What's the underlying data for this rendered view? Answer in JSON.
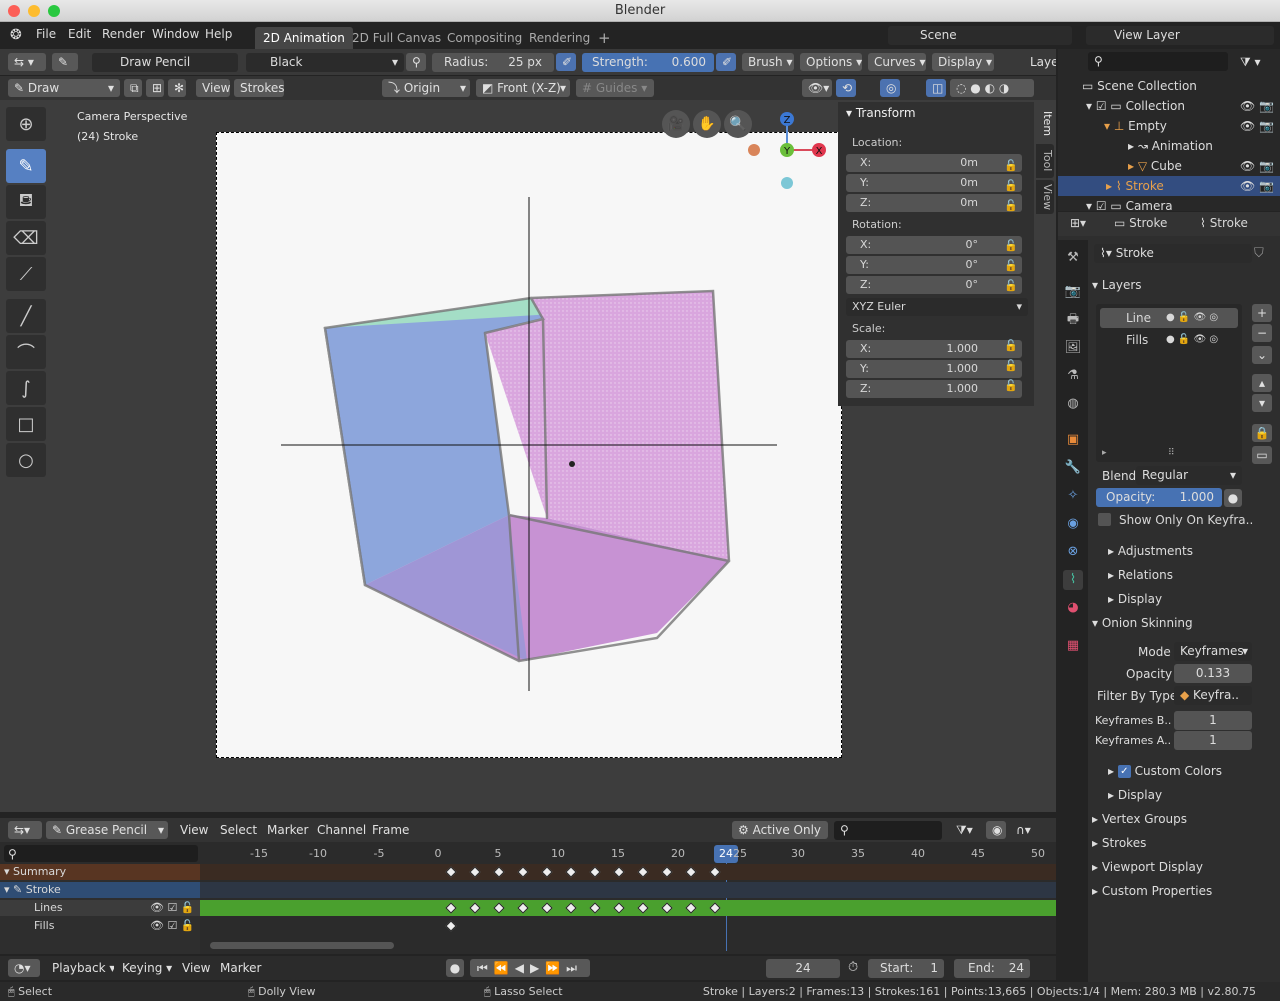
{
  "window": {
    "title": "Blender"
  },
  "menu": [
    "File",
    "Edit",
    "Render",
    "Window",
    "Help"
  ],
  "workspaces": [
    "2D Animation",
    "2D Full Canvas",
    "Compositing",
    "Rendering"
  ],
  "scene": {
    "label": "Scene",
    "view_layer": "View Layer"
  },
  "tool_header": {
    "brush": "Draw Pencil",
    "material": "Black",
    "radius_label": "Radius:",
    "radius_value": "25 px",
    "strength_label": "Strength:",
    "strength_value": "0.600",
    "brush_menu": "Brush",
    "options_menu": "Options",
    "curves_menu": "Curves",
    "display_menu": "Display",
    "layer_menu": "Layer"
  },
  "view_header": {
    "mode": "Draw",
    "view": "View",
    "strokes": "Strokes",
    "origin": "Origin",
    "plane": "Front (X-Z)",
    "guides": "Guides"
  },
  "viewport": {
    "camera": "Camera Perspective",
    "object": "(24) Stroke"
  },
  "gizmo": {
    "z": "Z",
    "y": "Y",
    "x": "X"
  },
  "npanel": {
    "title": "Transform",
    "location": "Location:",
    "rotation": "Rotation:",
    "scale": "Scale:",
    "euler": "XYZ Euler",
    "loc": [
      {
        "axis": "X:",
        "value": "0m"
      },
      {
        "axis": "Y:",
        "value": "0m"
      },
      {
        "axis": "Z:",
        "value": "0m"
      }
    ],
    "rot": [
      {
        "axis": "X:",
        "value": "0°"
      },
      {
        "axis": "Y:",
        "value": "0°"
      },
      {
        "axis": "Z:",
        "value": "0°"
      }
    ],
    "scl": [
      {
        "axis": "X:",
        "value": "1.000"
      },
      {
        "axis": "Y:",
        "value": "1.000"
      },
      {
        "axis": "Z:",
        "value": "1.000"
      }
    ],
    "tabs": [
      "Item",
      "Tool",
      "View"
    ]
  },
  "outliner": {
    "rows": [
      "Scene Collection",
      "Collection",
      "Empty",
      "Animation",
      "Cube",
      "Stroke",
      "Camera"
    ]
  },
  "properties": {
    "header_obj": "Stroke",
    "header_data": "Stroke",
    "datablock": "Stroke",
    "layers_title": "Layers",
    "layers": [
      "Line",
      "Fills"
    ],
    "blend_label": "Blend:",
    "blend_value": "Regular",
    "opacity_label": "Opacity:",
    "opacity_value": "1.000",
    "show_only": "Show Only On Keyfra..",
    "subs": [
      "Adjustments",
      "Relations",
      "Display"
    ],
    "onion": "Onion Skinning",
    "mode_label": "Mode",
    "mode_value": "Keyframes",
    "os_opacity_label": "Opacity",
    "os_opacity_value": "0.133",
    "filter_label": "Filter By Type",
    "filter_value": "Keyfra..",
    "kb_label": "Keyframes B..",
    "kb_value": "1",
    "ka_label": "Keyframes A..",
    "ka_value": "1",
    "custom_colors": "Custom Colors",
    "display2": "Display",
    "bottom": [
      "Vertex Groups",
      "Strokes",
      "Viewport Display",
      "Custom Properties"
    ]
  },
  "dopesheet": {
    "mode": "Grease Pencil",
    "menus": [
      "View",
      "Select",
      "Marker",
      "Channel",
      "Frame"
    ],
    "active_only": "Active Only",
    "ruler": [
      "-15",
      "-10",
      "-5",
      "0",
      "5",
      "10",
      "15",
      "20",
      "24",
      "25",
      "30",
      "35",
      "40",
      "45",
      "50"
    ],
    "channels": [
      "Summary",
      "Stroke",
      "Lines",
      "Fills"
    ]
  },
  "playback": {
    "menus": [
      "Playback",
      "Keying",
      "View",
      "Marker"
    ],
    "frame": "24",
    "start_label": "Start:",
    "start": "1",
    "end_label": "End:",
    "end": "24"
  },
  "status": {
    "select": "Select",
    "dolly": "Dolly View",
    "lasso": "Lasso Select",
    "info": "Stroke | Layers:2 | Frames:13 | Strokes:161 | Points:13,665 | Objects:1/4 | Mem: 280.3 MB | v2.80.75"
  }
}
